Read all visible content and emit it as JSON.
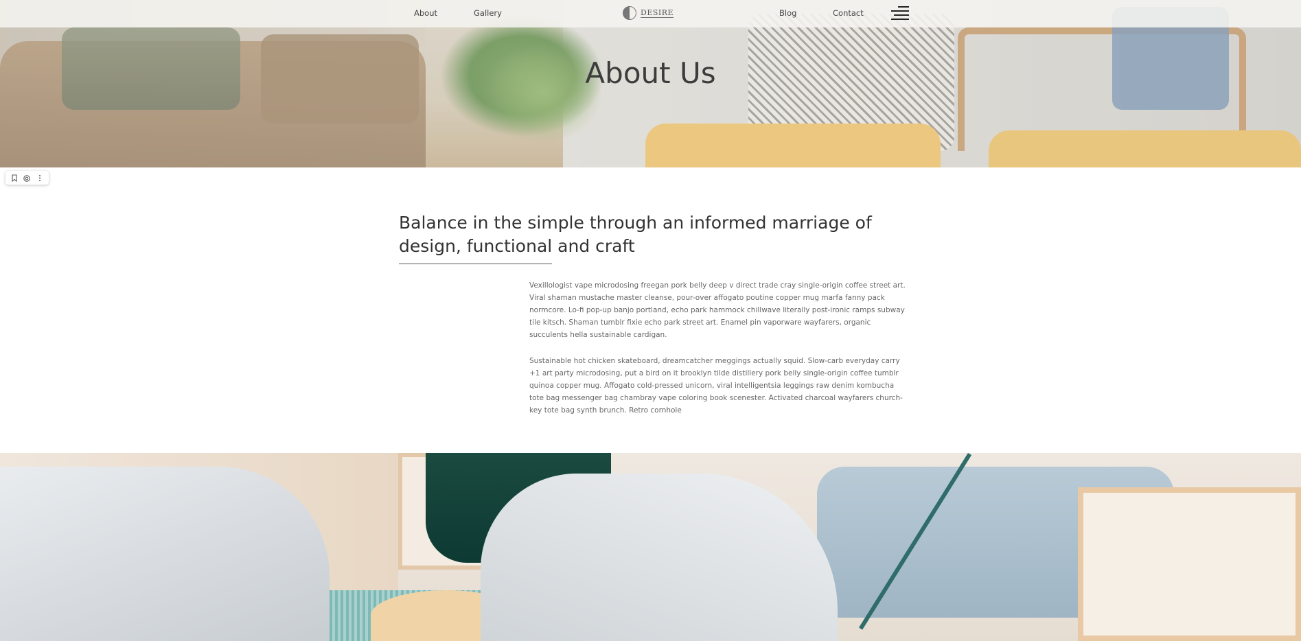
{
  "nav": {
    "left_links": [
      "About",
      "Gallery"
    ],
    "right_links": [
      "Blog",
      "Contact"
    ],
    "logo_text": "DESIRE",
    "menu_icon": "hamburger-menu-icon"
  },
  "hero": {
    "title": "About Us"
  },
  "toolbar": {
    "icons": [
      "bookmark-icon",
      "camera-icon",
      "more-vertical-icon"
    ]
  },
  "content": {
    "headline": "Balance in the simple through an informed marriage of design, functional and craft",
    "paragraphs": [
      "Vexillologist vape microdosing freegan pork belly deep v direct trade cray single-origin coffee street art. Viral shaman mustache master cleanse, pour-over affogato poutine copper mug marfa fanny pack normcore. Lo-fi pop-up banjo portland, echo park hammock chillwave literally post-ironic ramps subway tile kitsch. Shaman tumblr fixie echo park street art. Enamel pin vaporware wayfarers, organic succulents hella sustainable cardigan.",
      "Sustainable hot chicken skateboard, dreamcatcher meggings actually squid. Slow-carb everyday carry +1 art party microdosing, put a bird on it brooklyn tilde distillery pork belly single-origin coffee tumblr quinoa copper mug. Affogato cold-pressed unicorn, viral intelligentsia leggings raw denim kombucha tote bag messenger bag chambray vape coloring book scenester. Activated charcoal wayfarers church-key tote bag synth brunch. Retro cornhole"
    ]
  },
  "colors": {
    "text_dark": "#333333",
    "text_body": "#666666",
    "nav_bg": "#f5f4f0"
  }
}
